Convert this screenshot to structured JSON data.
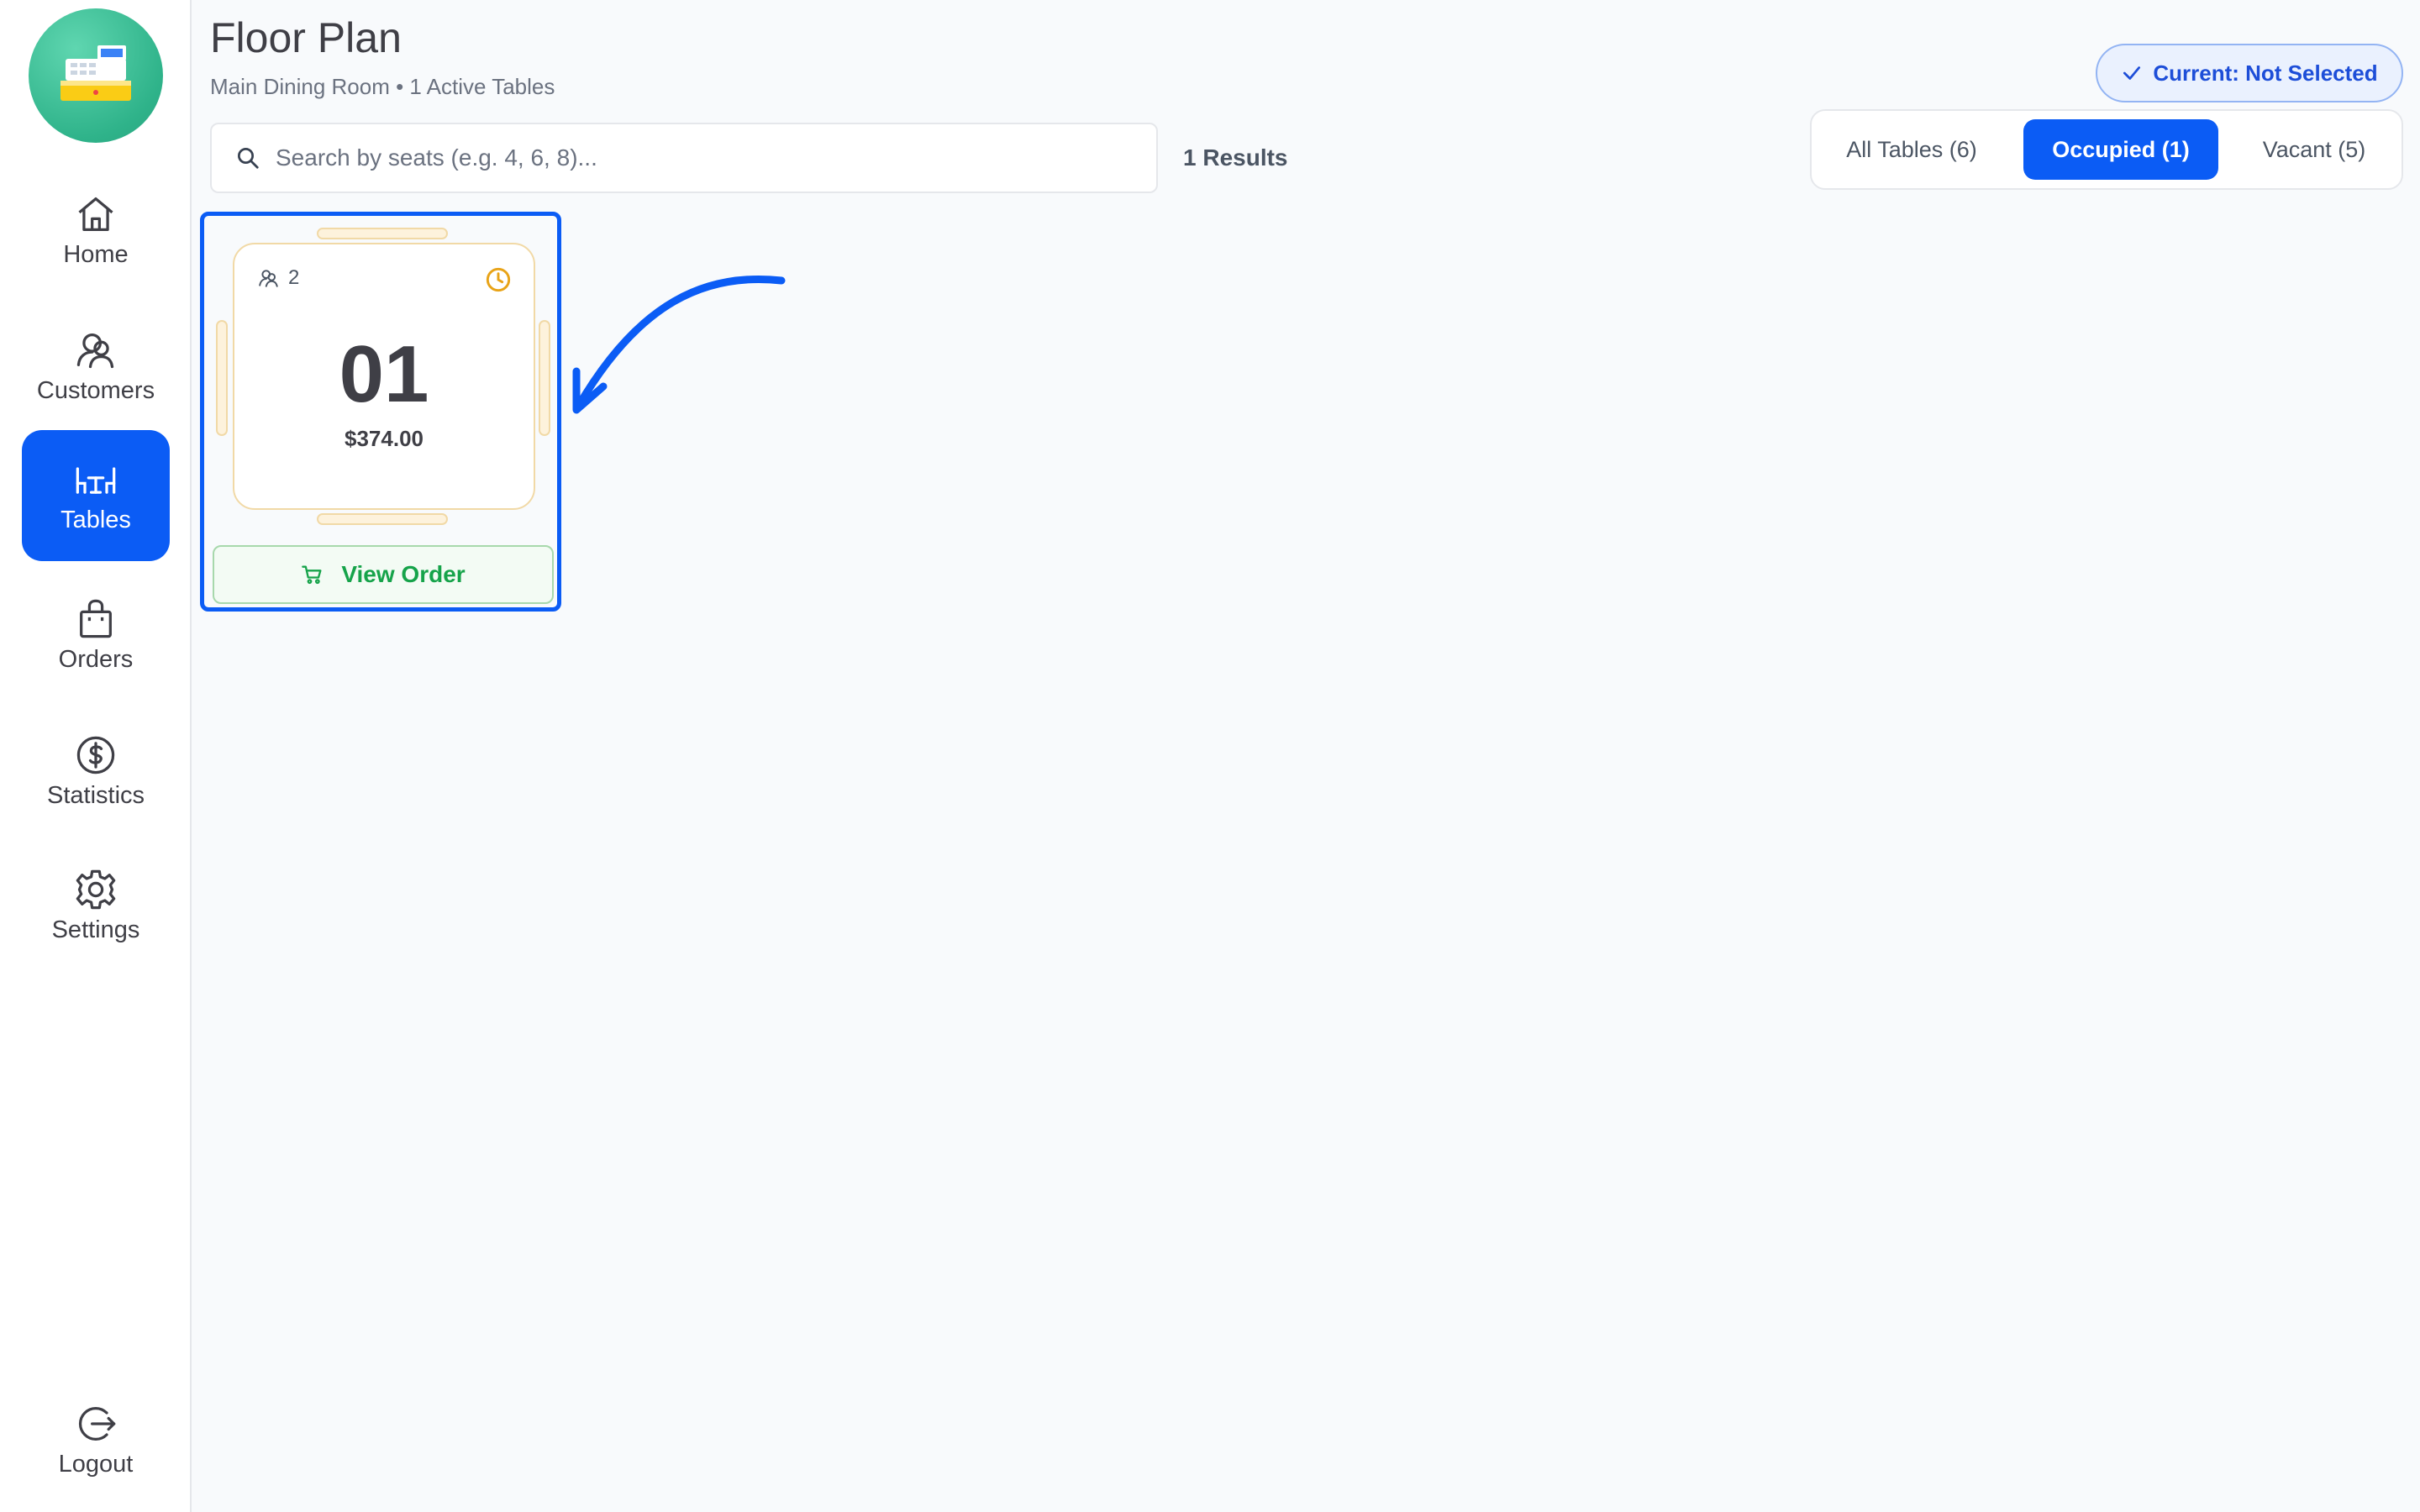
{
  "sidebar": {
    "logo_icon": "cash-register-icon",
    "items": [
      {
        "label": "Home",
        "icon": "home-icon"
      },
      {
        "label": "Customers",
        "icon": "customers-icon"
      },
      {
        "label": "Tables",
        "icon": "tables-icon",
        "active": true
      },
      {
        "label": "Orders",
        "icon": "shopping-bag-icon"
      },
      {
        "label": "Statistics",
        "icon": "dollar-circle-icon"
      },
      {
        "label": "Settings",
        "icon": "gear-icon"
      },
      {
        "label": "Logout",
        "icon": "logout-icon"
      }
    ]
  },
  "header": {
    "title": "Floor Plan",
    "subtitle": "Main Dining Room • 1 Active Tables",
    "current_badge": "Current: Not Selected"
  },
  "search": {
    "placeholder": "Search by seats (e.g. 4, 6, 8)...",
    "value": "",
    "results": "1 Results"
  },
  "filters": [
    {
      "label": "All Tables (6)",
      "active": false
    },
    {
      "label": "Occupied (1)",
      "active": true
    },
    {
      "label": "Vacant (5)",
      "active": false
    }
  ],
  "tables": [
    {
      "seats": "2",
      "number": "01",
      "amount": "$374.00",
      "action_label": "View Order",
      "selected": true
    }
  ],
  "colors": {
    "primary": "#0b5cf5",
    "sidebar_bg": "#ffffff",
    "page_bg": "#f8fafc",
    "logo_green": "#2fb38a",
    "chair_fill": "#fdf2dc",
    "clock_orange": "#e8a317",
    "order_green": "#16a34a"
  }
}
